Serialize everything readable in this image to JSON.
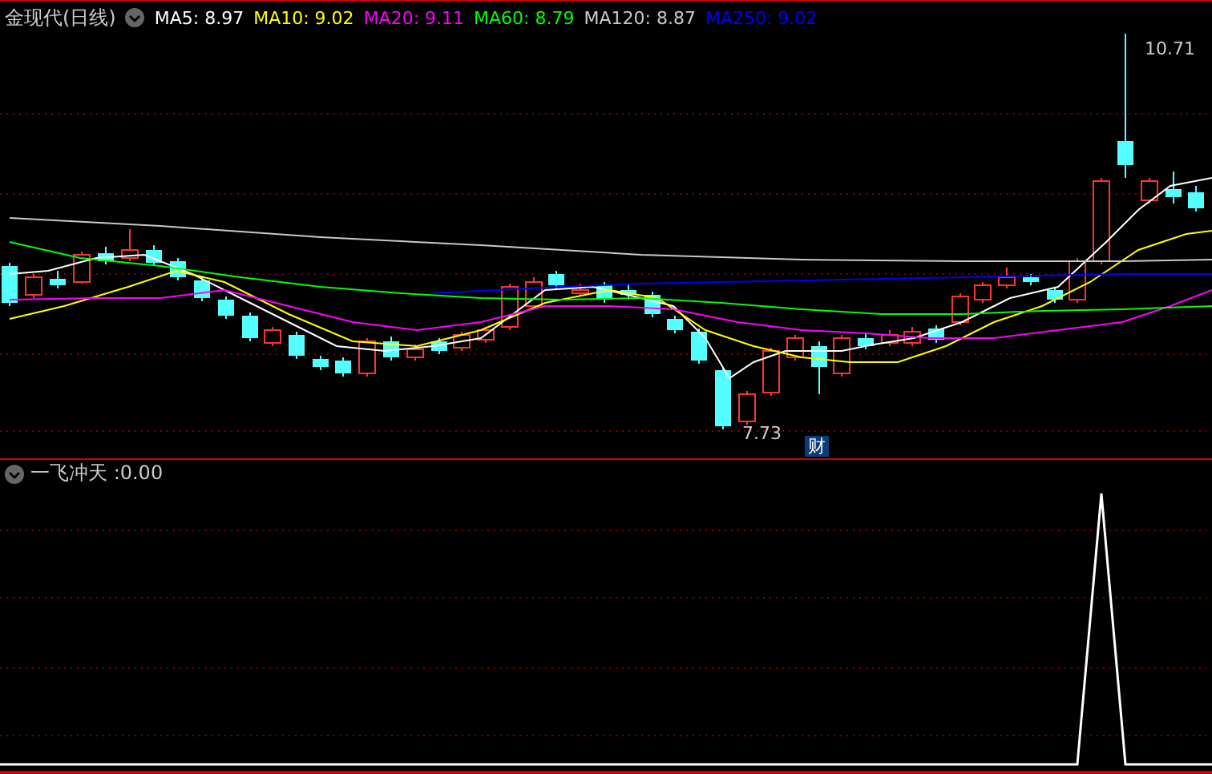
{
  "main_panel": {
    "title": "金现代(日线)",
    "ma_legend": [
      {
        "label": "MA5:",
        "value": "8.97",
        "color": "#ffffff"
      },
      {
        "label": "MA10:",
        "value": "9.02",
        "color": "#ffff00"
      },
      {
        "label": "MA20:",
        "value": "9.11",
        "color": "#ff00ff"
      },
      {
        "label": "MA60:",
        "value": "8.79",
        "color": "#00ff00"
      },
      {
        "label": "MA120:",
        "value": "8.87",
        "color": "#c8c8c8"
      },
      {
        "label": "MA250:",
        "value": "9.02",
        "color": "#0000ff"
      }
    ],
    "high_marker": "10.71",
    "low_marker": "7.73",
    "badge": "财"
  },
  "indicator_panel": {
    "title": "一飞冲天",
    "separator": ":",
    "value": "0.00"
  }
}
